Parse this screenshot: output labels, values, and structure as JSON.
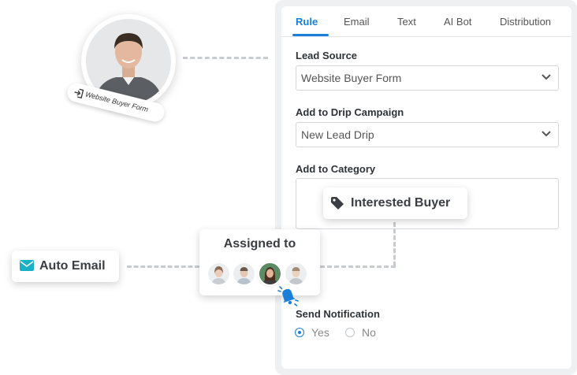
{
  "tabs": [
    {
      "label": "Rule",
      "active": true
    },
    {
      "label": "Email",
      "active": false
    },
    {
      "label": "Text",
      "active": false
    },
    {
      "label": "AI Bot",
      "active": false
    },
    {
      "label": "Distribution",
      "active": false
    }
  ],
  "lead_source": {
    "label": "Lead Source",
    "value": "Website Buyer Form"
  },
  "drip_campaign": {
    "label": "Add to Drip Campaign",
    "value": "New Lead Drip"
  },
  "category": {
    "label": "Add to Category",
    "tag": "Interested Buyer"
  },
  "source_badge": {
    "label": "Website Buyer Form"
  },
  "auto_email": {
    "label": "Auto Email"
  },
  "assigned": {
    "title": "Assigned to",
    "avatars": [
      "agent-1",
      "agent-2",
      "agent-3",
      "agent-4"
    ],
    "selected_index": 2
  },
  "notification": {
    "label": "Send Notification",
    "options": [
      "Yes",
      "No"
    ],
    "selected": "Yes"
  },
  "colors": {
    "accent": "#1a7fd8",
    "email_icon": "#1ab0c6",
    "bell": "#1a7fd8"
  },
  "icons": {
    "tag": "tag-icon",
    "mail": "mail-icon",
    "bell": "bell-icon",
    "chevron": "chevron-down-icon",
    "login": "login-icon"
  }
}
